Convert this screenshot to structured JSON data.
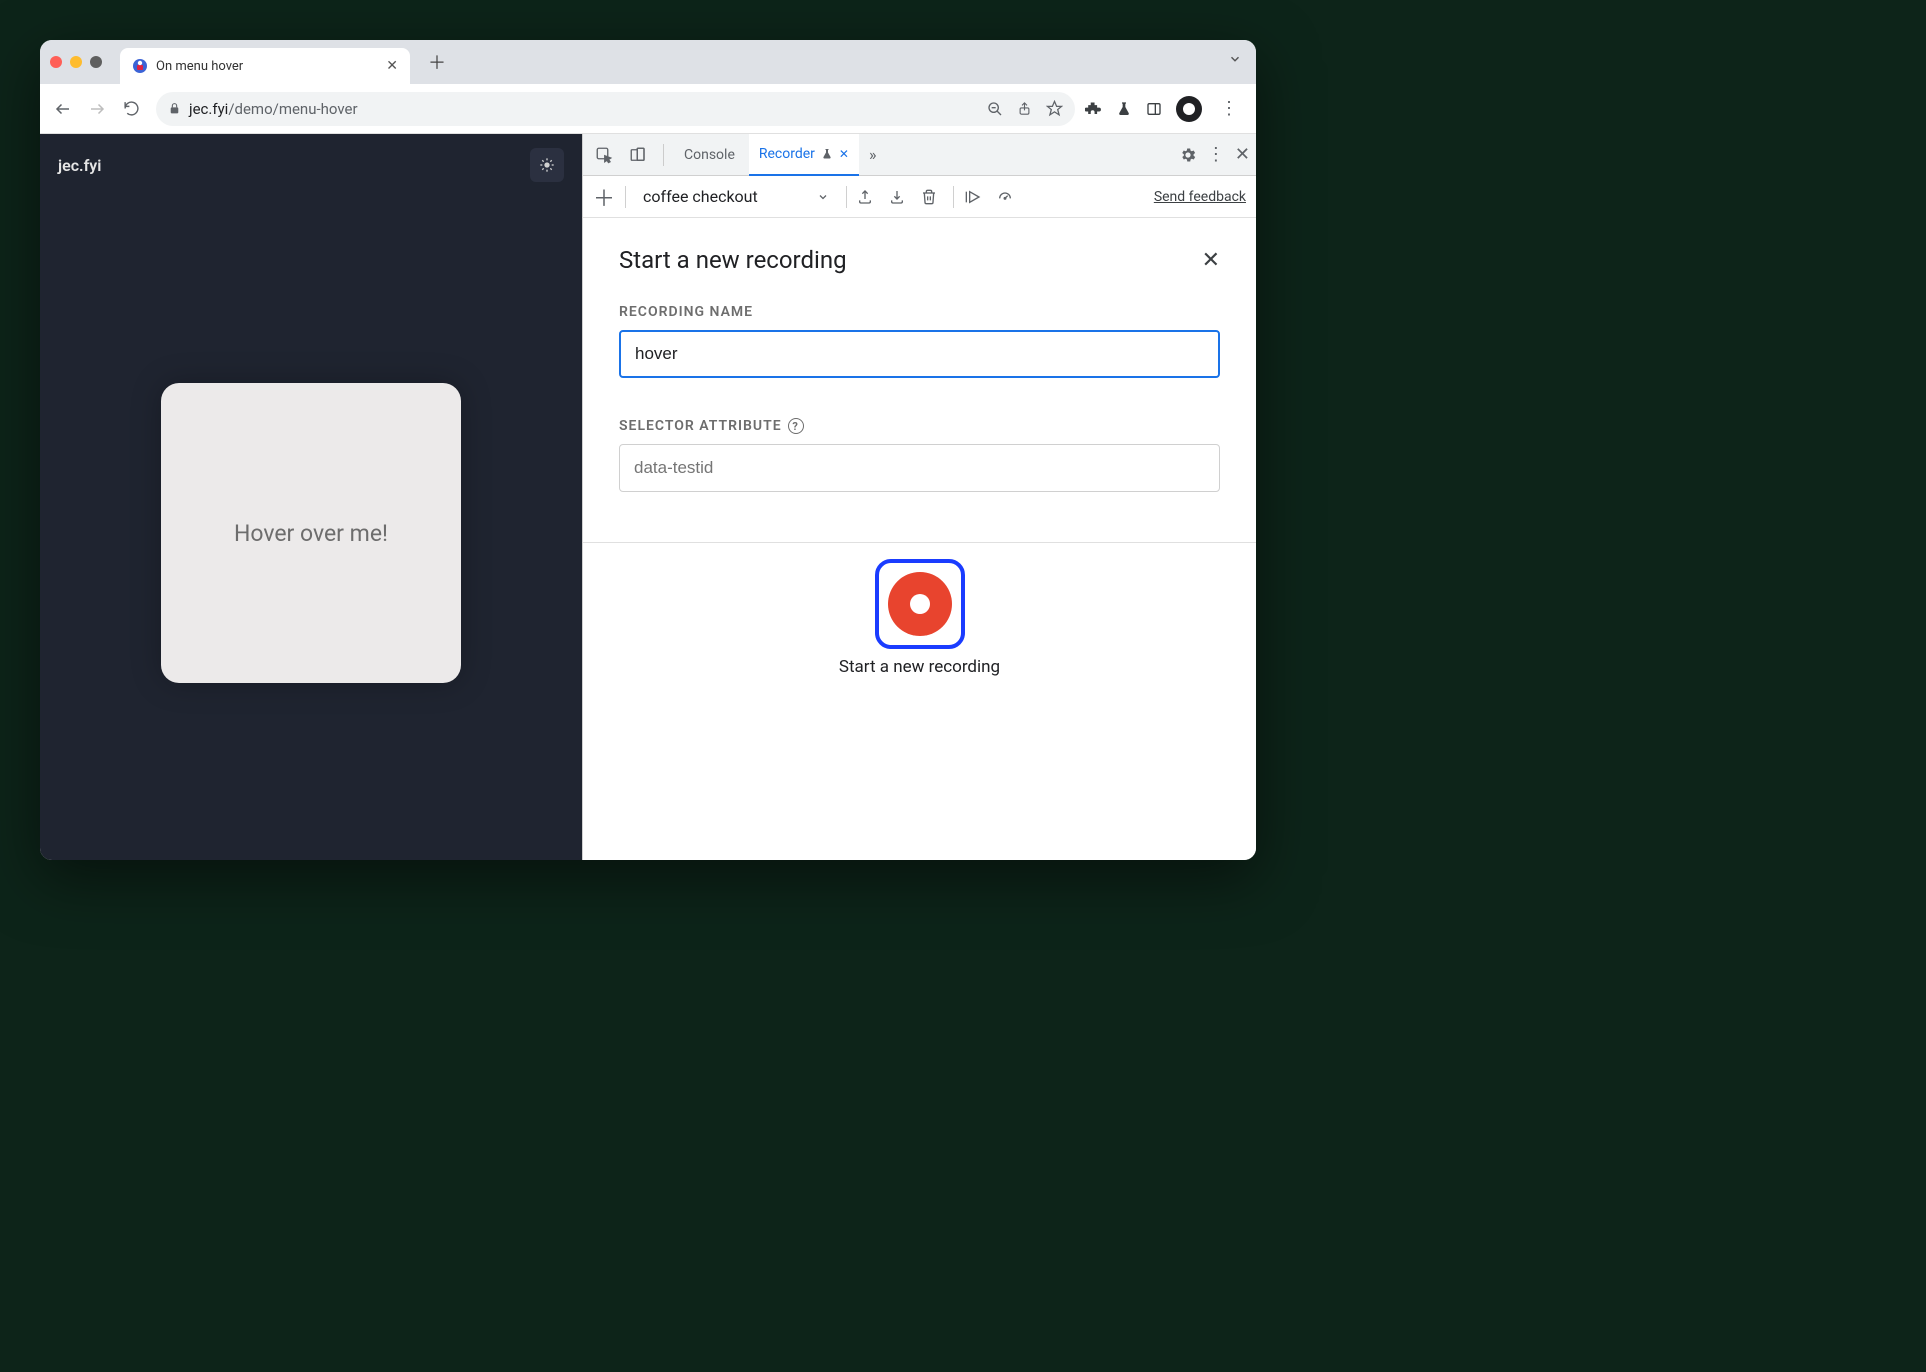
{
  "browser": {
    "tab_title": "On menu hover",
    "url_host": "jec.fyi",
    "url_path": "/demo/menu-hover"
  },
  "page": {
    "logo": "jec.fyi",
    "card_text": "Hover over me!"
  },
  "devtools": {
    "tabs": {
      "console": "Console",
      "recorder": "Recorder"
    },
    "toolbar": {
      "recording_name": "coffee checkout",
      "feedback": "Send feedback"
    },
    "panel": {
      "title": "Start a new recording",
      "name_label": "RECORDING NAME",
      "name_value": "hover",
      "selector_label": "SELECTOR ATTRIBUTE",
      "selector_placeholder": "data-testid",
      "record_label": "Start a new recording"
    }
  }
}
